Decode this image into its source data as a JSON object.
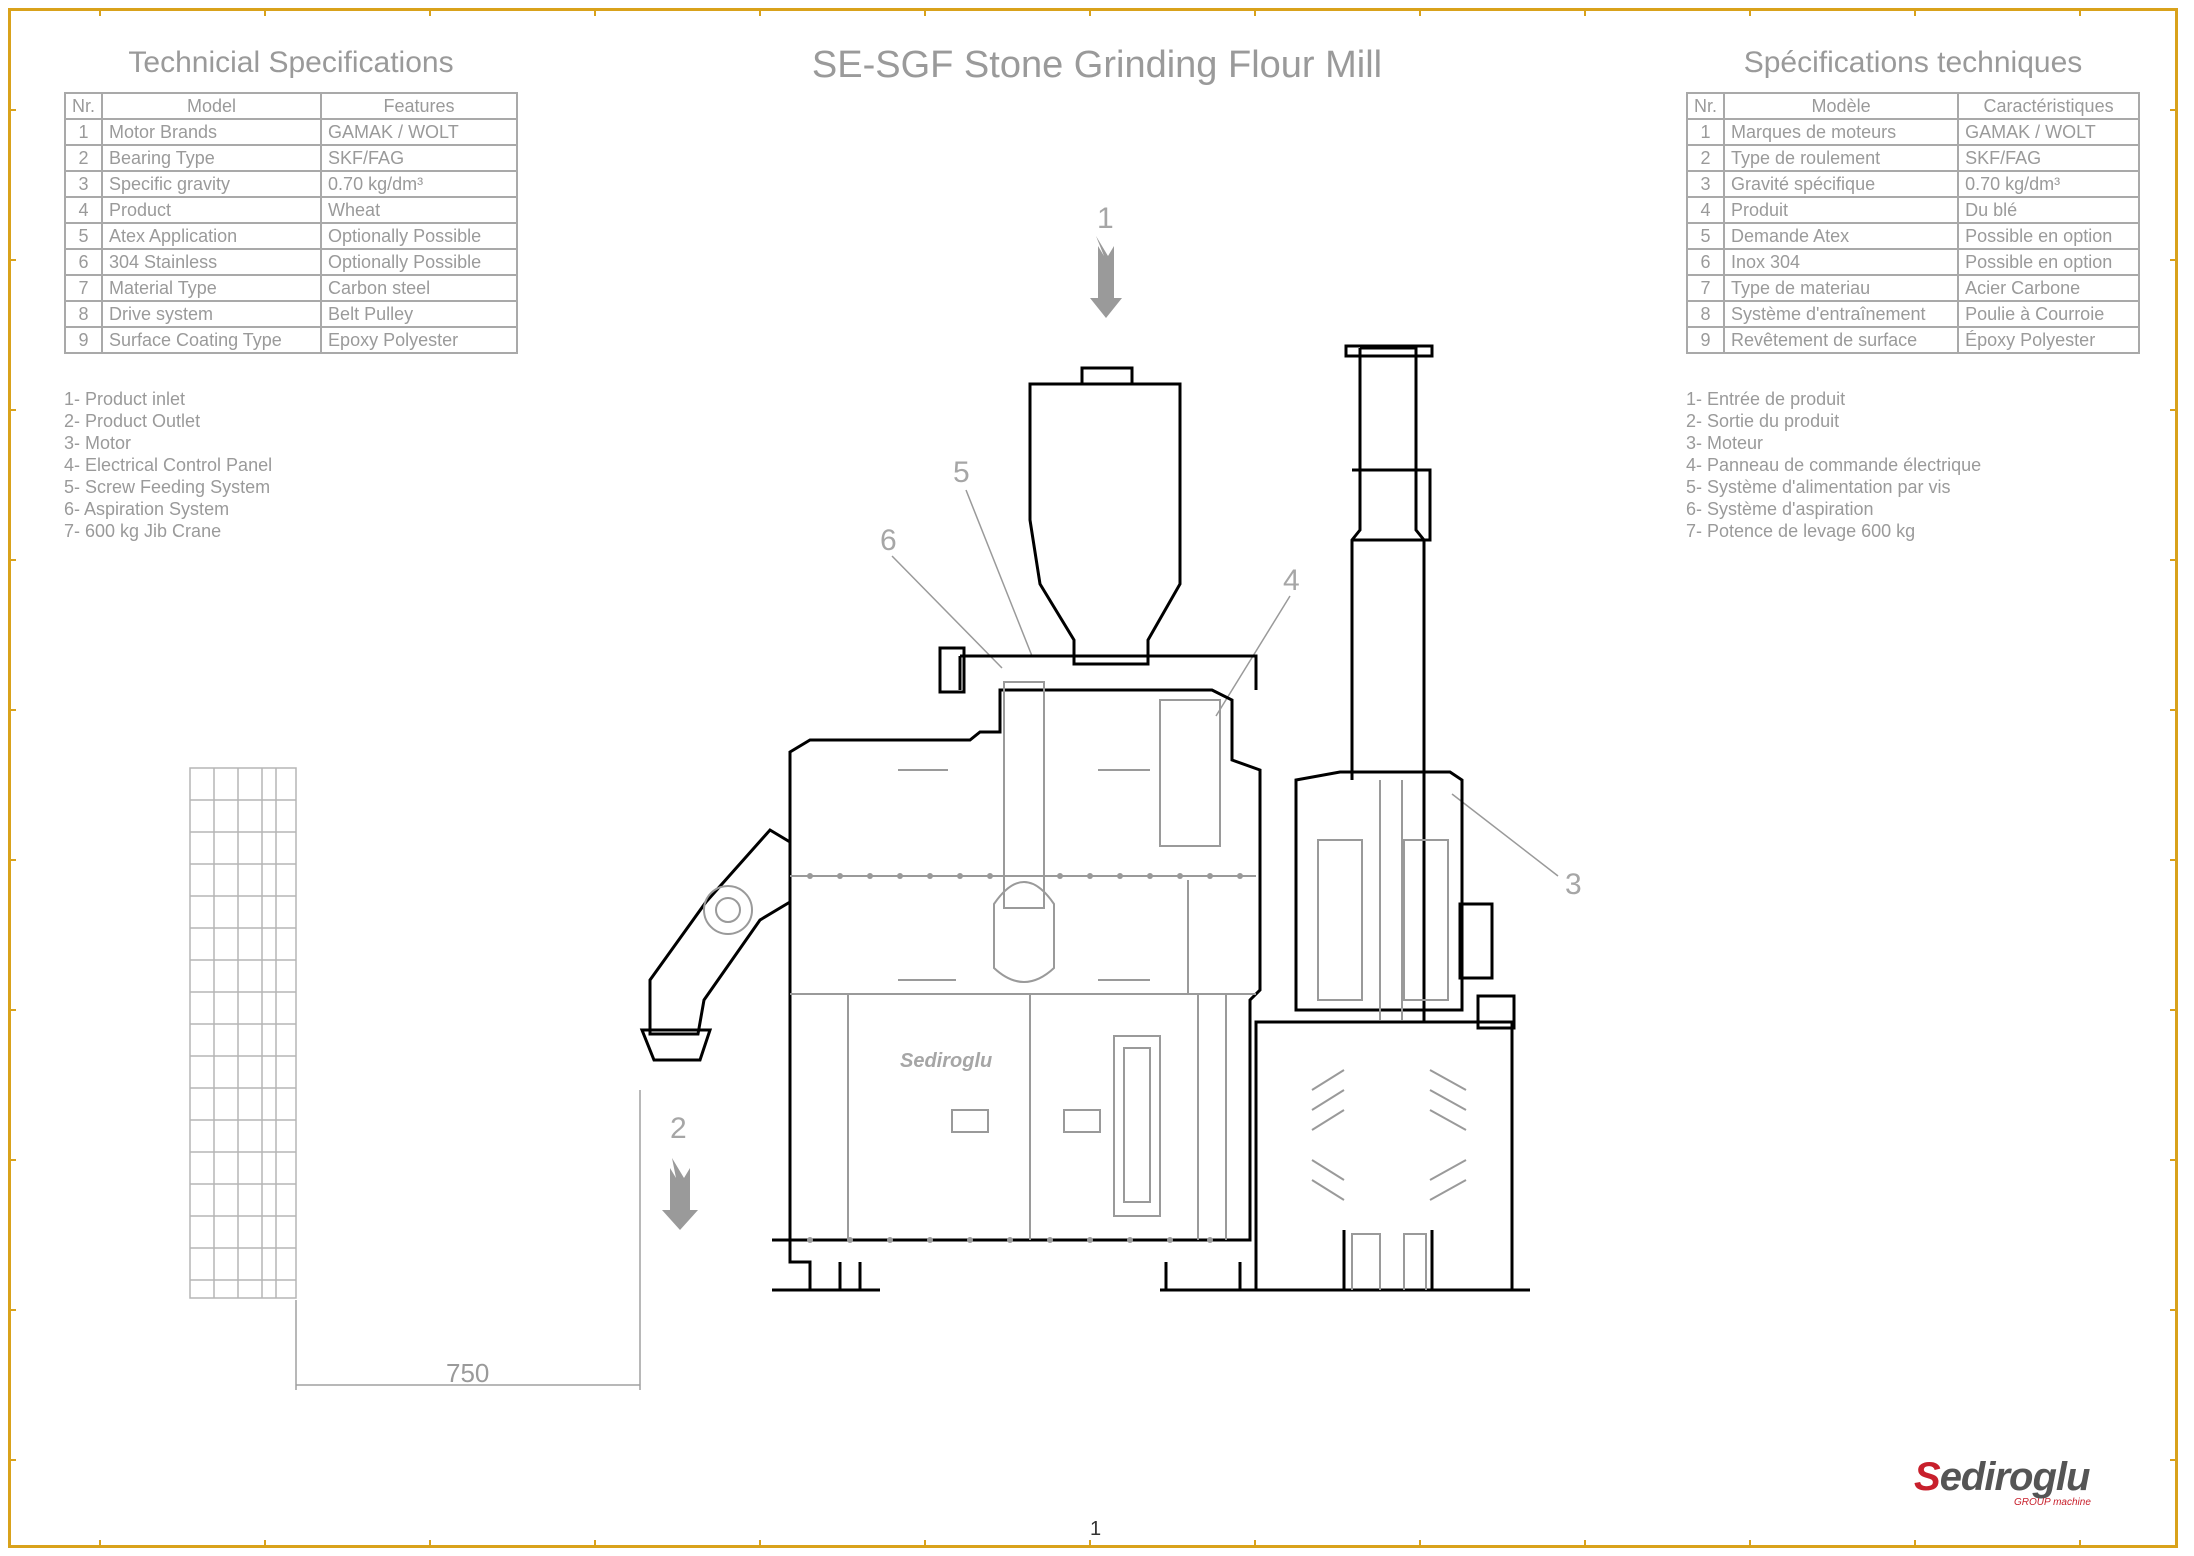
{
  "title": "SE-SGF Stone Grinding Flour Mill",
  "left_spec": {
    "title": "Technicial Specifications",
    "headers": [
      "Nr.",
      "Model",
      "Features"
    ],
    "rows": [
      [
        "1",
        "Motor  Brands",
        "GAMAK / WOLT"
      ],
      [
        "2",
        "Bearing Type",
        "SKF/FAG"
      ],
      [
        "3",
        "Specific gravity",
        "0.70 kg/dm³"
      ],
      [
        "4",
        "Product",
        "Wheat"
      ],
      [
        "5",
        "Atex Application",
        "Optionally Possible"
      ],
      [
        "6",
        "304 Stainless",
        "Optionally Possible"
      ],
      [
        "7",
        "Material Type",
        "Carbon steel"
      ],
      [
        "8",
        "Drive system",
        "Belt Pulley"
      ],
      [
        "9",
        "Surface Coating Type",
        "Epoxy Polyester"
      ]
    ]
  },
  "right_spec": {
    "title": "Spécifications techniques",
    "headers": [
      "Nr.",
      "Modèle",
      "Caractéristiques"
    ],
    "rows": [
      [
        "1",
        "Marques de moteurs",
        "GAMAK / WOLT"
      ],
      [
        "2",
        "Type de roulement",
        "SKF/FAG"
      ],
      [
        "3",
        "Gravité spécifique",
        "0.70 kg/dm³"
      ],
      [
        "4",
        "Produit",
        "Du blé"
      ],
      [
        "5",
        "Demande Atex",
        "Possible en option"
      ],
      [
        "6",
        "Inox 304",
        "Possible en option"
      ],
      [
        "7",
        "Type de materiau",
        "Acier Carbone"
      ],
      [
        "8",
        "Système d'entraînement",
        "Poulie à Courroie"
      ],
      [
        "9",
        "Revêtement de surface",
        "Époxy Polyester"
      ]
    ]
  },
  "left_legend": [
    "1- Product inlet",
    "2- Product Outlet",
    "3- Motor",
    "4- Electrical Control Panel",
    "5- Screw Feeding System",
    "6- Aspiration System",
    "7- 600 kg Jib Crane"
  ],
  "right_legend": [
    "1- Entrée de produit",
    "2- Sortie du produit",
    "3- Moteur",
    "4- Panneau de commande électrique",
    "5- Système d'alimentation par vis",
    "6- Système d'aspiration",
    "7- Potence de levage 600 kg"
  ],
  "callouts": {
    "c1": "1",
    "c2": "2",
    "c3": "3",
    "c4": "4",
    "c5": "5",
    "c6": "6"
  },
  "machine_brand": "Sediroglu",
  "dimension": "750",
  "page_number": "1",
  "logo": {
    "initial": "S",
    "rest": "ediroglu",
    "sub": "GROUP machine"
  },
  "colors": {
    "frame": "#d9a21b",
    "text": "#9a9a9a",
    "outline": "#000000",
    "logo_red": "#c8202c"
  }
}
